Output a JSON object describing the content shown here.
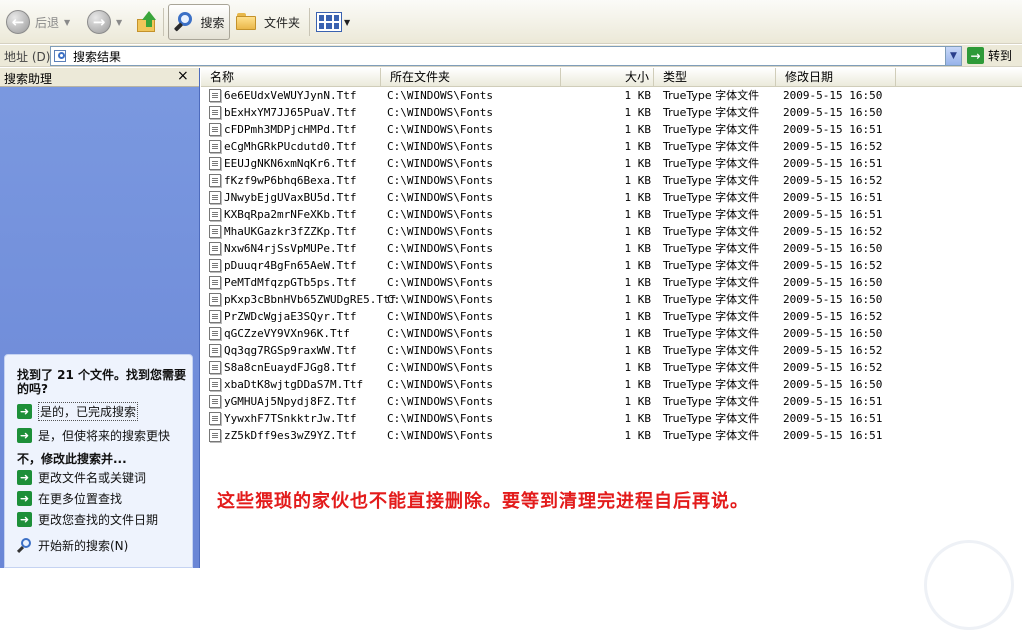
{
  "toolbar": {
    "back_label": "后退",
    "search_label": "搜索",
    "folders_label": "文件夹"
  },
  "address": {
    "label": "地址 (D)",
    "value": "搜索结果",
    "go_label": "转到"
  },
  "left_pane": {
    "title": "搜索助理",
    "close_glyph": "×",
    "question": "找到了 21 个文件。找到您需要的吗?",
    "options": [
      "是的，已完成搜索",
      "是，但使将来的搜索更快"
    ],
    "refine_heading": "不，修改此搜索并...",
    "refine_options": [
      "更改文件名或关键词",
      "在更多位置查找",
      "更改您查找的文件日期"
    ],
    "new_search": "开始新的搜索(N)"
  },
  "columns": {
    "name": "名称",
    "folder": "所在文件夹",
    "size": "大小",
    "type": "类型",
    "modified": "修改日期"
  },
  "files": [
    {
      "name": "6e6EUdxVeWUYJynN.Ttf",
      "folder": "C:\\WINDOWS\\Fonts",
      "size": "1 KB",
      "type": "TrueType 字体文件",
      "date": "2009-5-15 16:50"
    },
    {
      "name": "bExHxYM7JJ65PuaV.Ttf",
      "folder": "C:\\WINDOWS\\Fonts",
      "size": "1 KB",
      "type": "TrueType 字体文件",
      "date": "2009-5-15 16:50"
    },
    {
      "name": "cFDPmh3MDPjcHMPd.Ttf",
      "folder": "C:\\WINDOWS\\Fonts",
      "size": "1 KB",
      "type": "TrueType 字体文件",
      "date": "2009-5-15 16:51"
    },
    {
      "name": "eCgMhGRkPUcdutd0.Ttf",
      "folder": "C:\\WINDOWS\\Fonts",
      "size": "1 KB",
      "type": "TrueType 字体文件",
      "date": "2009-5-15 16:52"
    },
    {
      "name": "EEUJgNKN6xmNqKr6.Ttf",
      "folder": "C:\\WINDOWS\\Fonts",
      "size": "1 KB",
      "type": "TrueType 字体文件",
      "date": "2009-5-15 16:51"
    },
    {
      "name": "fKzf9wP6bhq6Bexa.Ttf",
      "folder": "C:\\WINDOWS\\Fonts",
      "size": "1 KB",
      "type": "TrueType 字体文件",
      "date": "2009-5-15 16:52"
    },
    {
      "name": "JNwybEjgUVaxBU5d.Ttf",
      "folder": "C:\\WINDOWS\\Fonts",
      "size": "1 KB",
      "type": "TrueType 字体文件",
      "date": "2009-5-15 16:51"
    },
    {
      "name": "KXBqRpa2mrNFeXKb.Ttf",
      "folder": "C:\\WINDOWS\\Fonts",
      "size": "1 KB",
      "type": "TrueType 字体文件",
      "date": "2009-5-15 16:51"
    },
    {
      "name": "MhaUKGazkr3fZZKp.Ttf",
      "folder": "C:\\WINDOWS\\Fonts",
      "size": "1 KB",
      "type": "TrueType 字体文件",
      "date": "2009-5-15 16:52"
    },
    {
      "name": "Nxw6N4rjSsVpMUPe.Ttf",
      "folder": "C:\\WINDOWS\\Fonts",
      "size": "1 KB",
      "type": "TrueType 字体文件",
      "date": "2009-5-15 16:50"
    },
    {
      "name": "pDuuqr4BgFn65AeW.Ttf",
      "folder": "C:\\WINDOWS\\Fonts",
      "size": "1 KB",
      "type": "TrueType 字体文件",
      "date": "2009-5-15 16:52"
    },
    {
      "name": "PeMTdMfqzpGTb5ps.Ttf",
      "folder": "C:\\WINDOWS\\Fonts",
      "size": "1 KB",
      "type": "TrueType 字体文件",
      "date": "2009-5-15 16:50"
    },
    {
      "name": "pKxp3cBbnHVb65ZWUDgRE5.Ttf",
      "folder": "C:\\WINDOWS\\Fonts",
      "size": "1 KB",
      "type": "TrueType 字体文件",
      "date": "2009-5-15 16:50"
    },
    {
      "name": "PrZWDcWgjaE3SQyr.Ttf",
      "folder": "C:\\WINDOWS\\Fonts",
      "size": "1 KB",
      "type": "TrueType 字体文件",
      "date": "2009-5-15 16:52"
    },
    {
      "name": "qGCZzeVY9VXn96K.Ttf",
      "folder": "C:\\WINDOWS\\Fonts",
      "size": "1 KB",
      "type": "TrueType 字体文件",
      "date": "2009-5-15 16:50"
    },
    {
      "name": "Qq3qg7RGSp9raxWW.Ttf",
      "folder": "C:\\WINDOWS\\Fonts",
      "size": "1 KB",
      "type": "TrueType 字体文件",
      "date": "2009-5-15 16:52"
    },
    {
      "name": "S8a8cnEuaydFJGg8.Ttf",
      "folder": "C:\\WINDOWS\\Fonts",
      "size": "1 KB",
      "type": "TrueType 字体文件",
      "date": "2009-5-15 16:52"
    },
    {
      "name": "xbaDtK8wjtgDDaS7M.Ttf",
      "folder": "C:\\WINDOWS\\Fonts",
      "size": "1 KB",
      "type": "TrueType 字体文件",
      "date": "2009-5-15 16:50"
    },
    {
      "name": "yGMHUAj5Npydj8FZ.Ttf",
      "folder": "C:\\WINDOWS\\Fonts",
      "size": "1 KB",
      "type": "TrueType 字体文件",
      "date": "2009-5-15 16:51"
    },
    {
      "name": "YywxhF7TSnkktrJw.Ttf",
      "folder": "C:\\WINDOWS\\Fonts",
      "size": "1 KB",
      "type": "TrueType 字体文件",
      "date": "2009-5-15 16:51"
    },
    {
      "name": "zZ5kDff9es3wZ9YZ.Ttf",
      "folder": "C:\\WINDOWS\\Fonts",
      "size": "1 KB",
      "type": "TrueType 字体文件",
      "date": "2009-5-15 16:51"
    }
  ],
  "annotation": "这些猥琐的家伙也不能直接删除。要等到清理完进程自后再说。",
  "colors": {
    "annotation": "#e31b1b",
    "pane_blue": "#7b99e0",
    "toolbar_bg": "#ece9d8"
  }
}
